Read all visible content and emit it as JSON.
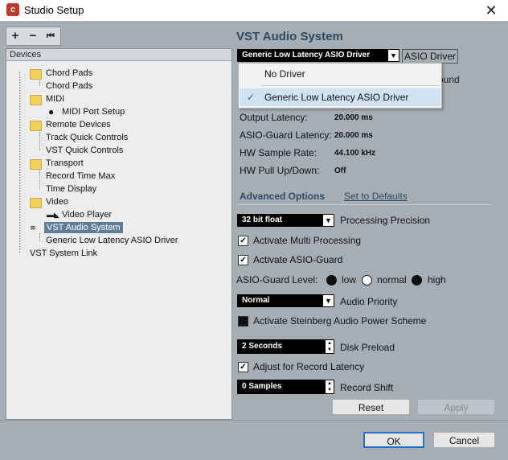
{
  "window": {
    "title": "Studio Setup",
    "close": "✕",
    "app_icon": "cubase-icon"
  },
  "toolbar": {
    "add": "+",
    "remove": "−",
    "reset": "⏮"
  },
  "tree": {
    "header": "Devices",
    "items": [
      {
        "label": "Chord Pads"
      },
      {
        "label": "Chord Pads"
      },
      {
        "label": "MIDI"
      },
      {
        "label": "MIDI Port Setup"
      },
      {
        "label": "Remote Devices"
      },
      {
        "label": "Track Quick Controls"
      },
      {
        "label": "VST Quick Controls"
      },
      {
        "label": "Transport"
      },
      {
        "label": "Record Time Max"
      },
      {
        "label": "Time Display"
      },
      {
        "label": "Video"
      },
      {
        "label": "Video Player"
      },
      {
        "label": "VST Audio System"
      },
      {
        "label": "Generic Low Latency ASIO Driver"
      },
      {
        "label": "VST System Link"
      }
    ]
  },
  "panel": {
    "title": "VST Audio System",
    "driver_value": "Generic Low Latency ASIO Driver",
    "asio_driver_btn": "ASIO Driver",
    "obscured_text": "ound",
    "dropdown": {
      "options": [
        "No Driver",
        "Generic Low Latency ASIO Driver"
      ],
      "selected": "Generic Low Latency ASIO Driver",
      "check": "✓"
    },
    "info": [
      {
        "label": "Output Latency:",
        "value": "20.000 ms"
      },
      {
        "label": "ASIO-Guard Latency:",
        "value": "20.000 ms"
      },
      {
        "label": "HW Sample Rate:",
        "value": "44.100 kHz"
      },
      {
        "label": "HW Pull Up/Down:",
        "value": "Off"
      }
    ],
    "advanced_label": "Advanced Options",
    "defaults_link": "Set to Defaults",
    "processing_precision": {
      "value": "32 bit float",
      "label": "Processing Precision"
    },
    "multi_processing": {
      "label": "Activate Multi Processing",
      "checked": true
    },
    "asio_guard": {
      "label": "Activate ASIO-Guard",
      "checked": true
    },
    "asio_guard_level": {
      "label": "ASIO-Guard Level:",
      "options": [
        "low",
        "normal",
        "high"
      ],
      "selected": "normal"
    },
    "audio_priority": {
      "value": "Normal",
      "label": "Audio Priority"
    },
    "power_scheme": {
      "label": "Activate Steinberg Audio Power Scheme",
      "checked": false
    },
    "disk_preload": {
      "value": "2 Seconds",
      "label": "Disk Preload"
    },
    "adjust_latency": {
      "label": "Adjust for Record Latency",
      "checked": true
    },
    "record_shift": {
      "value": "0 Samples",
      "label": "Record Shift"
    },
    "reset_btn": "Reset",
    "apply_btn": "Apply"
  },
  "footer": {
    "ok": "OK",
    "cancel": "Cancel"
  }
}
